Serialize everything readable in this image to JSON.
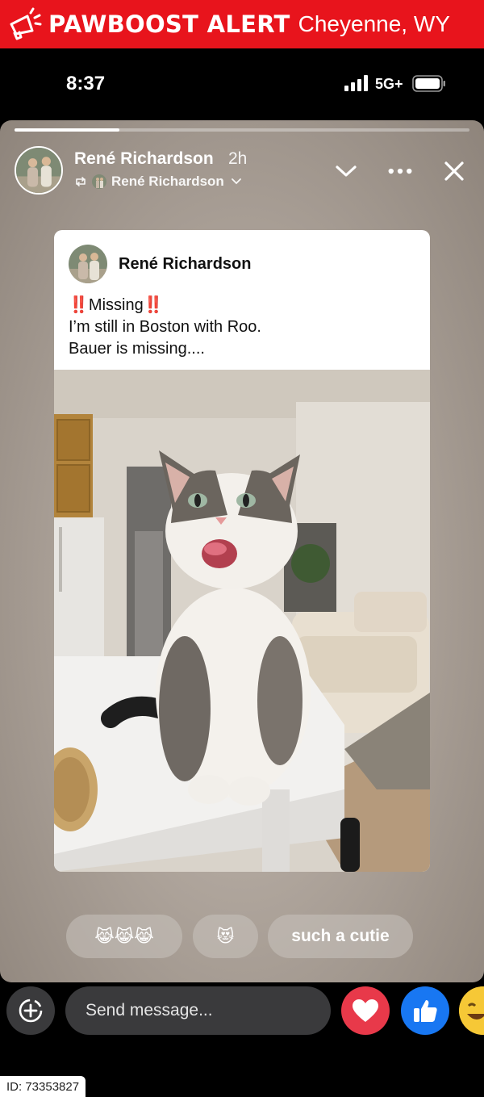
{
  "alert": {
    "brand": "PAWBOOST ALERT",
    "city": "Cheyenne, WY"
  },
  "status_bar": {
    "time": "8:37",
    "network": "5G+"
  },
  "story": {
    "progress_fraction": 0.23,
    "author": "René Richardson",
    "time_ago": "2h",
    "reshared_by": "René Richardson"
  },
  "post": {
    "author": "René Richardson",
    "line1": "Missing",
    "line1_prefix": "‼️",
    "line1_suffix": "‼️",
    "line2": "I’m still in Boston with Roo.",
    "line3": "Bauer is missing...."
  },
  "quick_replies": [
    {
      "label": "😹😹😹"
    },
    {
      "label": "😻"
    },
    {
      "label": "such a cutie"
    }
  ],
  "composer": {
    "placeholder": "Send message..."
  },
  "footer": {
    "id_label": "ID: 73353827"
  },
  "icons": [
    "megaphone-icon",
    "signal-icon",
    "battery-icon",
    "repost-icon",
    "chevron-down-icon",
    "more-icon",
    "close-icon",
    "add-circle-icon",
    "heart-icon",
    "like-icon",
    "laugh-emoji-icon"
  ],
  "colors": {
    "alert_red": "#e8141c",
    "heart_red": "#e8394a",
    "like_blue": "#1877f2"
  }
}
